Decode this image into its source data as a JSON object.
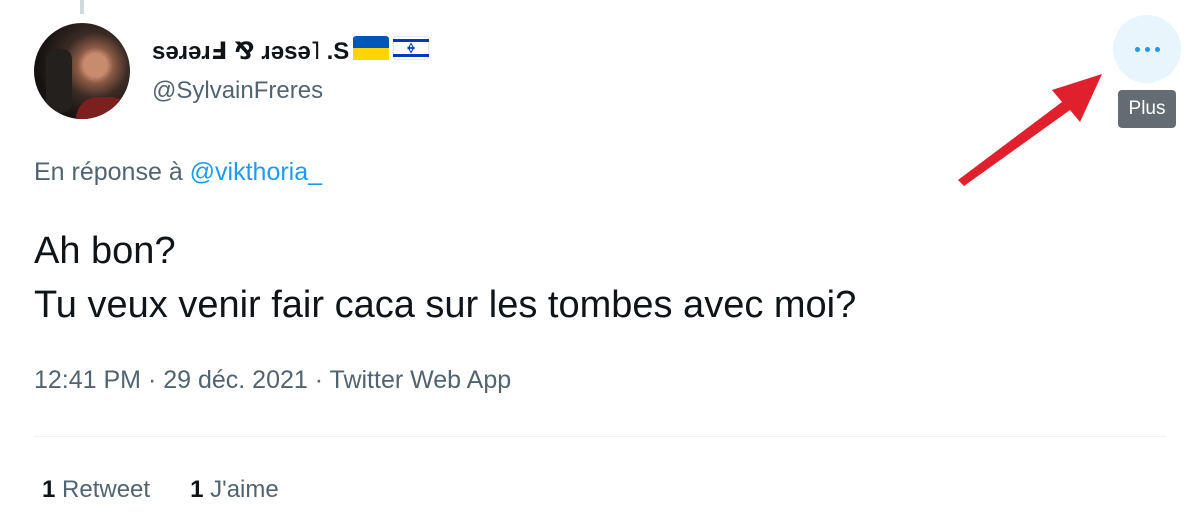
{
  "tweet": {
    "author": {
      "display_name": "sǝɹǝɹℲ ⅋ ɹǝsǝ˥ .S",
      "flags": [
        "flag-ukraine-icon",
        "flag-israel-icon"
      ],
      "handle": "@SylvainFreres"
    },
    "more_tooltip": "Plus",
    "reply": {
      "prefix": "En réponse à",
      "mention": "@vikthoria_"
    },
    "text_lines": [
      "Ah bon?",
      "Tu veux venir fair caca sur les tombes avec moi?"
    ],
    "meta": "12:41 PM · 29 déc. 2021 · Twitter Web App",
    "stats": {
      "retweets": {
        "count": "1",
        "label": "Retweet"
      },
      "likes": {
        "count": "1",
        "label": "J'aime"
      }
    }
  },
  "colors": {
    "accent": "#1d9bf0",
    "secondary_text": "#536471",
    "annotation_arrow": "#e0202c",
    "tooltip_bg": "#636c72"
  }
}
